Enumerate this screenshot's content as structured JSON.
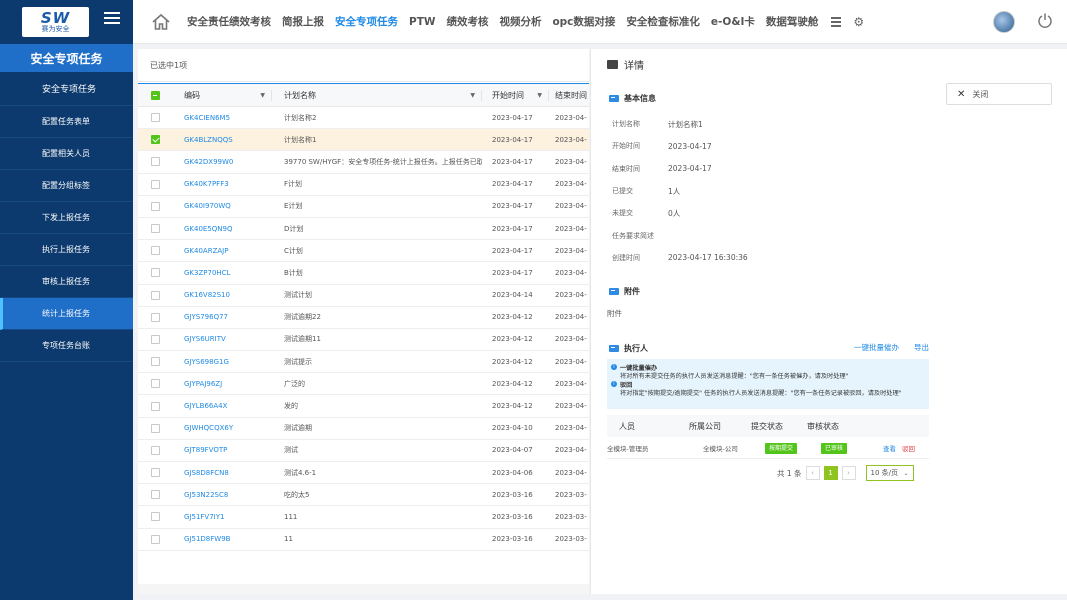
{
  "sidebar": {
    "logo_text": "SW",
    "logo_sub": "赛为安全",
    "title": "安全专项任务",
    "items": [
      {
        "label": "安全专项任务"
      },
      {
        "label": "配置任务表单"
      },
      {
        "label": "配置相关人员"
      },
      {
        "label": "配置分组标签"
      },
      {
        "label": "下发上报任务"
      },
      {
        "label": "执行上报任务"
      },
      {
        "label": "审核上报任务"
      },
      {
        "label": "统计上报任务"
      },
      {
        "label": "专项任务台账"
      }
    ],
    "active_index": 7
  },
  "topnav": {
    "items": [
      "安全责任绩效考核",
      "简报上报",
      "安全专项任务",
      "PTW",
      "绩效考核",
      "视频分析",
      "opc数据对接",
      "安全检查标准化",
      "e-O&I卡",
      "数据驾驶舱"
    ],
    "active": "安全专项任务"
  },
  "table": {
    "selected_text": "已选中1项",
    "headers": {
      "code": "编码",
      "name": "计划名称",
      "start": "开始时间",
      "end": "结束时间"
    },
    "rows": [
      {
        "code": "GK4CIEN6M5",
        "name": "计划名称2",
        "start": "2023-04-17",
        "end": "2023-04-",
        "checked": false
      },
      {
        "code": "GK4BLZNQQS",
        "name": "计划名称1",
        "start": "2023-04-17",
        "end": "2023-04-",
        "checked": true
      },
      {
        "code": "GK42DX99W0",
        "name": "39770 SW/HYGF：安全专项任务-统计上报任务。上报任务已取...",
        "start": "2023-04-17",
        "end": "2023-04-",
        "checked": false
      },
      {
        "code": "GK40K7PFF3",
        "name": "F计划",
        "start": "2023-04-17",
        "end": "2023-04-",
        "checked": false
      },
      {
        "code": "GK40I970WQ",
        "name": "E计划",
        "start": "2023-04-17",
        "end": "2023-04-",
        "checked": false
      },
      {
        "code": "GK40E5QN9Q",
        "name": "D计划",
        "start": "2023-04-17",
        "end": "2023-04-",
        "checked": false
      },
      {
        "code": "GK40ARZAJP",
        "name": "C计划",
        "start": "2023-04-17",
        "end": "2023-04-",
        "checked": false
      },
      {
        "code": "GK3ZP70HCL",
        "name": "B计划",
        "start": "2023-04-17",
        "end": "2023-04-",
        "checked": false
      },
      {
        "code": "GK16V82S10",
        "name": "测试计划",
        "start": "2023-04-14",
        "end": "2023-04-",
        "checked": false
      },
      {
        "code": "GJYS796Q77",
        "name": "测试逾期22",
        "start": "2023-04-12",
        "end": "2023-04-",
        "checked": false
      },
      {
        "code": "GJYS6URITV",
        "name": "测试逾期11",
        "start": "2023-04-12",
        "end": "2023-04-",
        "checked": false
      },
      {
        "code": "GJYS698G1G",
        "name": "测试提示",
        "start": "2023-04-12",
        "end": "2023-04-",
        "checked": false
      },
      {
        "code": "GJYPAJ96ZJ",
        "name": "广泛的",
        "start": "2023-04-12",
        "end": "2023-04-",
        "checked": false
      },
      {
        "code": "GJYLB66A4X",
        "name": "发的",
        "start": "2023-04-12",
        "end": "2023-04-",
        "checked": false
      },
      {
        "code": "GJWHQCQX6Y",
        "name": "测试逾期",
        "start": "2023-04-10",
        "end": "2023-04-",
        "checked": false
      },
      {
        "code": "GJT89FVOTP",
        "name": "测试",
        "start": "2023-04-07",
        "end": "2023-04-",
        "checked": false
      },
      {
        "code": "GJS8D8FCN8",
        "name": "测试4.6-1",
        "start": "2023-04-06",
        "end": "2023-04-",
        "checked": false
      },
      {
        "code": "GJ53N22SC8",
        "name": "吃的太5",
        "start": "2023-03-16",
        "end": "2023-03-",
        "checked": false
      },
      {
        "code": "GJ51FV7IY1",
        "name": "111",
        "start": "2023-03-16",
        "end": "2023-03-",
        "checked": false
      },
      {
        "code": "GJ51D8FW9B",
        "name": "11",
        "start": "2023-03-16",
        "end": "2023-03-",
        "checked": false
      }
    ]
  },
  "detail": {
    "title": "详情",
    "close_label": "关闭",
    "basic_title": "基本信息",
    "basic": [
      {
        "k": "计划名称",
        "v": "计划名称1"
      },
      {
        "k": "开始时间",
        "v": "2023-04-17"
      },
      {
        "k": "结束时间",
        "v": "2023-04-17"
      },
      {
        "k": "已提交",
        "v": "1人"
      },
      {
        "k": "未提交",
        "v": "0人"
      },
      {
        "k": "任务要求简述",
        "v": ""
      },
      {
        "k": "创建时间",
        "v": "2023-04-17 16:30:36"
      }
    ],
    "attach_title": "附件",
    "attach_text": "附件",
    "exec_title": "执行人",
    "batch_remind": "一键批量催办",
    "export": "导出",
    "tips": {
      "t1": "一键批量催办",
      "d1": "将对所有未提交任务的执行人员发送消息提醒：\"您有一条任务被催办，请及时处理\"",
      "t2": "驳回",
      "d2": "将对指定\"按期提交/逾期提交\" 任务的执行人员发送消息提醒：\"您有一条任务记录被驳回，请及时处理\""
    },
    "exec_headers": {
      "person": "人员",
      "company": "所属公司",
      "submit": "提交状态",
      "review": "审核状态"
    },
    "exec_row": {
      "person": "全模块-管理员",
      "company": "全模块-公司",
      "submit": "按期提交",
      "review": "已审核",
      "view": "查看",
      "reject": "驳回"
    },
    "pager": {
      "total": "共 1 条",
      "page": "1",
      "size": "10 条/页"
    }
  }
}
